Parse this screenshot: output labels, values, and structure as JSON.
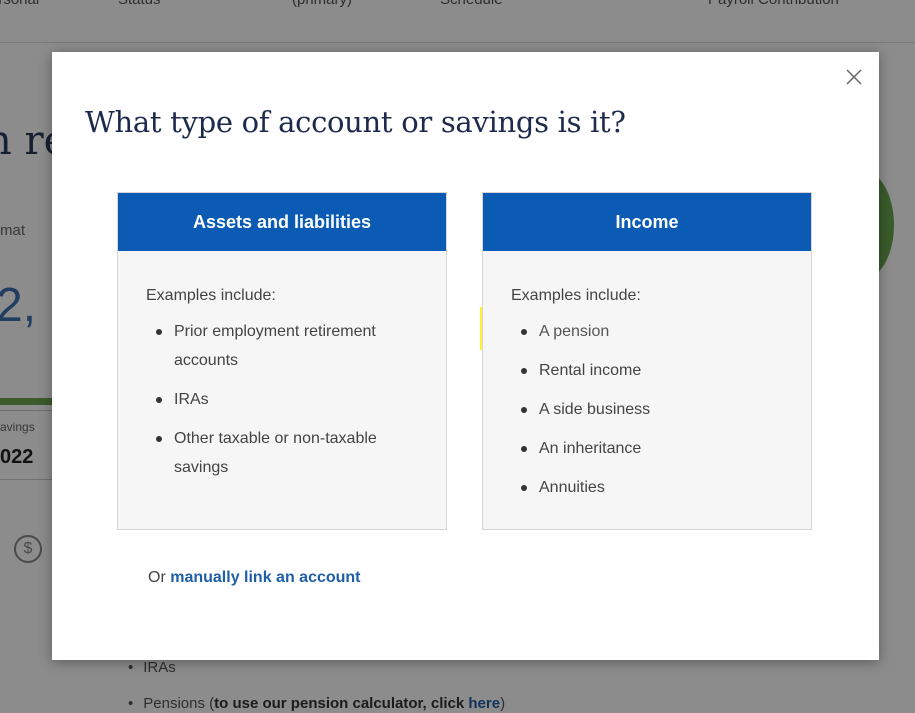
{
  "background": {
    "nav_items": [
      "ersonal",
      "Status",
      "(primary)",
      "Schedule",
      "Payroll Contribution"
    ],
    "heading_fragment": "n re",
    "sublabel_fragment": "mat",
    "big_number_fragment": "2,",
    "card_label_fragment": "avings",
    "card_year_fragment": "022",
    "list": {
      "item1": "IRAs",
      "item2_prefix": "Pensions (",
      "item2_bold": "to use our pension calculator, click ",
      "item2_link": "here",
      "item2_suffix": ")"
    }
  },
  "modal": {
    "title": "What type of account or savings is it?",
    "close_icon": "close-icon",
    "cards": [
      {
        "title": "Assets and liabilities",
        "intro": "Examples include:",
        "items": [
          "Prior employment retirement accounts",
          "IRAs",
          "Other taxable or non-taxable savings"
        ]
      },
      {
        "title": "Income",
        "intro": "Examples include:",
        "items": [
          "A pension",
          "Rental income",
          "A side business",
          "An inheritance",
          "Annuities"
        ]
      }
    ],
    "footer": {
      "prefix": "Or",
      "link": "manually link an account"
    }
  },
  "colors": {
    "card_header": "#0b5bb5",
    "title": "#1d2a4d",
    "link": "#1f5fa8",
    "highlight": "#fdf22f"
  }
}
